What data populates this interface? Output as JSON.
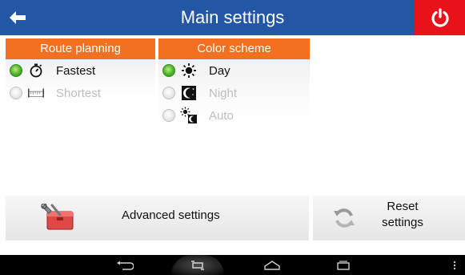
{
  "header": {
    "title": "Main settings",
    "back_icon": "back-arrow-icon",
    "power_icon": "power-icon",
    "bg_color": "#2356a5",
    "power_color": "#e8131a"
  },
  "route_planning": {
    "title": "Route planning",
    "options": [
      {
        "label": "Fastest",
        "icon": "stopwatch-icon",
        "selected": true
      },
      {
        "label": "Shortest",
        "icon": "ruler-icon",
        "selected": false
      }
    ]
  },
  "color_scheme": {
    "title": "Color scheme",
    "options": [
      {
        "label": "Day",
        "icon": "sun-icon",
        "selected": true
      },
      {
        "label": "Night",
        "icon": "moon-icon",
        "selected": false
      },
      {
        "label": "Auto",
        "icon": "sun-moon-icon",
        "selected": false
      }
    ]
  },
  "buttons": {
    "advanced_label": "Advanced settings",
    "advanced_icon": "toolbox-icon",
    "reset_label": "Reset settings",
    "reset_icon": "refresh-icon"
  },
  "navbar": {
    "items": [
      "back-nav-icon",
      "screenshot-nav-icon",
      "home-nav-icon",
      "recents-nav-icon",
      "menu-dots-icon"
    ]
  },
  "accent_color": "#f37021"
}
